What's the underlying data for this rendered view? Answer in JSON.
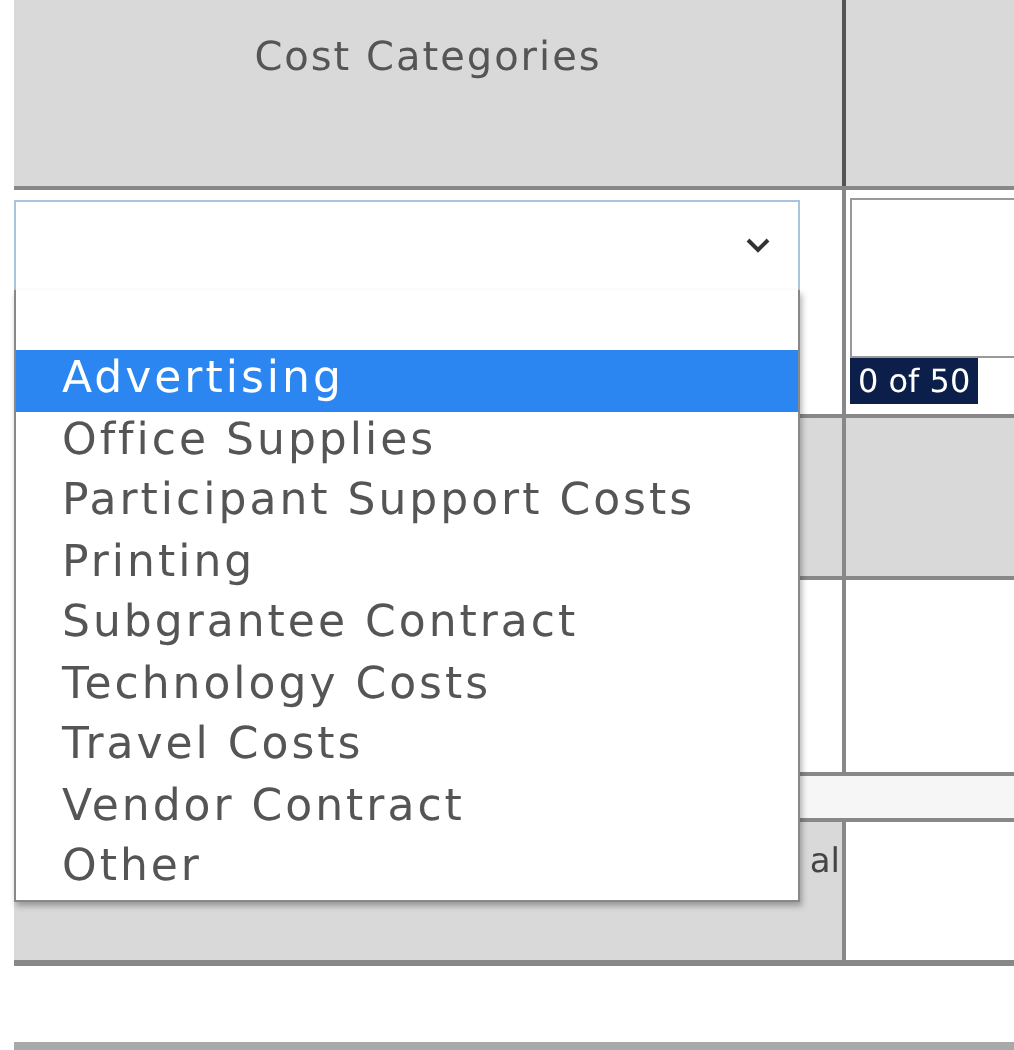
{
  "table": {
    "columns": [
      {
        "label": "Cost Categories"
      }
    ]
  },
  "select": {
    "counter": "0 of 50",
    "options": [
      {
        "label": "Advertising",
        "selected": true
      },
      {
        "label": "Office Supplies",
        "selected": false
      },
      {
        "label": "Participant Support Costs",
        "selected": false
      },
      {
        "label": "Printing",
        "selected": false
      },
      {
        "label": "Subgrantee Contract",
        "selected": false
      },
      {
        "label": "Technology Costs",
        "selected": false
      },
      {
        "label": "Travel Costs",
        "selected": false
      },
      {
        "label": "Vendor Contract",
        "selected": false
      },
      {
        "label": "Other",
        "selected": false
      }
    ]
  },
  "row_label": "al"
}
